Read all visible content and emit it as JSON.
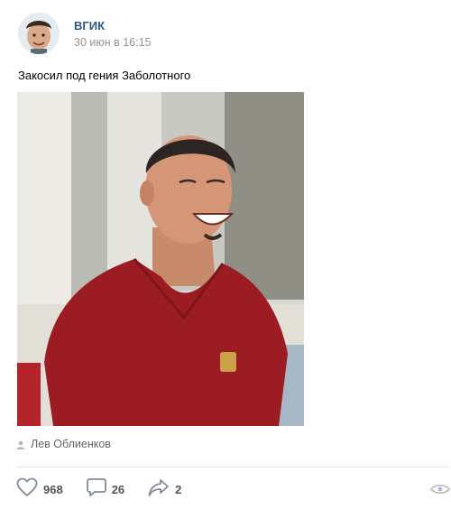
{
  "post": {
    "author": "ВГИК",
    "date": "30 июн в 16:15",
    "text": "Закосил под гения Заболотного",
    "signer": "Лев Облиенков"
  },
  "actions": {
    "likes": "968",
    "comments": "26",
    "shares": "2"
  },
  "icons": {
    "like": "heart-icon",
    "comment": "comment-icon",
    "share": "share-arrow-icon",
    "views": "eye-icon",
    "signer": "user-icon"
  },
  "colors": {
    "author": "#2a5885",
    "date": "#939393",
    "icons": "#818c99"
  }
}
